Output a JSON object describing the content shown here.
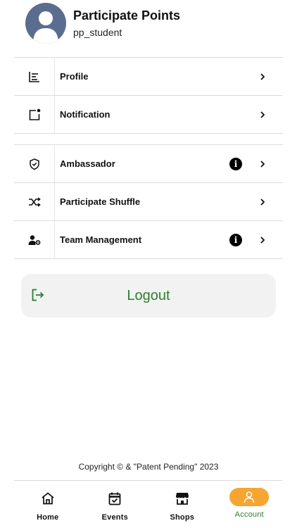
{
  "header": {
    "app_name": "Participate Points",
    "username": "pp_student"
  },
  "menu_group_1": [
    {
      "label": "Profile",
      "icon": "chart-list-icon",
      "has_info": false
    },
    {
      "label": "Notification",
      "icon": "notification-square-icon",
      "has_info": false
    }
  ],
  "menu_group_2": [
    {
      "label": "Ambassador",
      "icon": "shield-check-icon",
      "has_info": true
    },
    {
      "label": "Participate Shuffle",
      "icon": "shuffle-icon",
      "has_info": false
    },
    {
      "label": "Team Management",
      "icon": "user-gear-icon",
      "has_info": true
    }
  ],
  "info_glyph": "i",
  "logout": {
    "label": "Logout",
    "icon": "logout-icon"
  },
  "footer": {
    "copyright": "Copyright © & \"Patent Pending\" 2023"
  },
  "nav": [
    {
      "label": "Home",
      "icon": "home-icon",
      "active": false
    },
    {
      "label": "Events",
      "icon": "calendar-icon",
      "active": false
    },
    {
      "label": "Shops",
      "icon": "store-icon",
      "active": false
    },
    {
      "label": "Account",
      "icon": "person-icon",
      "active": true
    }
  ],
  "colors": {
    "accent_green": "#2e7d32",
    "active_pill": "#f5a530",
    "avatar_bg": "#5b6d8f",
    "logout_bg": "#f1f2f1"
  }
}
